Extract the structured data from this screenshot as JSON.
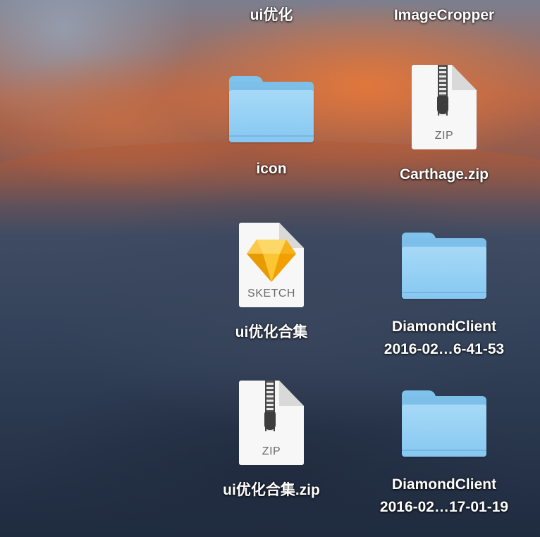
{
  "desktop": {
    "items": [
      {
        "label": "ui优化",
        "kind": "folder-partial"
      },
      {
        "label": "ImageCropper",
        "kind": "folder-partial"
      },
      {
        "label": "icon",
        "kind": "folder"
      },
      {
        "label": "Carthage.zip",
        "kind": "zip",
        "ext": "ZIP"
      },
      {
        "label": "ui优化合集",
        "kind": "sketch",
        "ext": "SKETCH"
      },
      {
        "label_lines": [
          "DiamondClient",
          "2016-02…6-41-53"
        ],
        "kind": "folder"
      },
      {
        "label": "ui优化合集.zip",
        "kind": "zip",
        "ext": "ZIP"
      },
      {
        "label_lines": [
          "DiamondClient",
          "2016-02…17-01-19"
        ],
        "kind": "folder"
      }
    ]
  },
  "colors": {
    "folder": "#93cff4",
    "sketch_gem": "#f7b500",
    "label_text": "#ffffff"
  }
}
